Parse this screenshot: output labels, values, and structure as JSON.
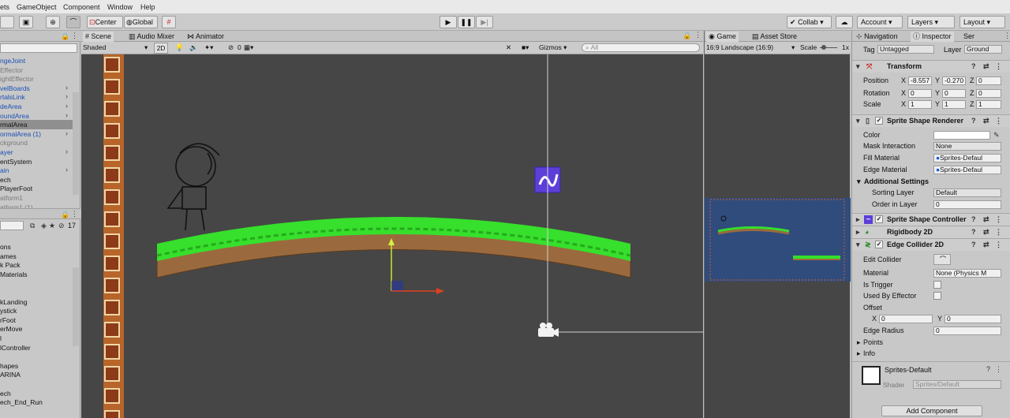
{
  "menu": {
    "items": [
      "ets",
      "GameObject",
      "Component",
      "Window",
      "Help"
    ]
  },
  "toolbar": {
    "center": "Center",
    "global": "Global",
    "collab": "Collab ▾",
    "account": "Account ▾",
    "layers": "Layers ▾",
    "layout": "Layout ▾"
  },
  "hierarchy": {
    "items": [
      {
        "label": "ngeJoint",
        "cls": "blue"
      },
      {
        "label": "Effector",
        "cls": "grey"
      },
      {
        "label": "ightEffector",
        "cls": "grey"
      },
      {
        "label": "velBoards",
        "cls": "blue"
      },
      {
        "label": "rtalsLink",
        "cls": "blue"
      },
      {
        "label": "deArea",
        "cls": "blue"
      },
      {
        "label": "oundArea",
        "cls": "blue"
      },
      {
        "label": "rmalArea",
        "cls": "sel"
      },
      {
        "label": "ormalArea (1)",
        "cls": "blue"
      },
      {
        "label": "ckground",
        "cls": "grey"
      },
      {
        "label": "ayer",
        "cls": "blue"
      },
      {
        "label": "entSystem",
        "cls": ""
      },
      {
        "label": "ain",
        "cls": "blue"
      },
      {
        "label": "ech",
        "cls": ""
      },
      {
        "label": "PlayerFoot",
        "cls": ""
      },
      {
        "label": "atform1",
        "cls": "grey"
      },
      {
        "label": "atform1 (1)",
        "cls": "grey"
      }
    ],
    "count": "17",
    "project_items": [
      "ons",
      "ames",
      "k Pack",
      "Materials",
      "",
      "",
      "kLanding",
      "ystick",
      "rFoot",
      "erMove",
      "l",
      "lController",
      "",
      "hapes",
      "ARINA",
      "",
      "ech",
      "ech_End_Run"
    ]
  },
  "scene": {
    "tabs": [
      "Scene",
      "Audio Mixer",
      "Animator"
    ],
    "shaded": "Shaded",
    "mode2d": "2D",
    "layers_count": "0",
    "gizmos": "Gizmos",
    "search_placeholder": "All"
  },
  "game": {
    "tabs": [
      "Game",
      "Asset Store"
    ],
    "aspect": "16:9 Landscape (16:9)",
    "scale_label": "Scale",
    "scale_value": "1x"
  },
  "inspector": {
    "tabs": [
      "Navigation",
      "Inspector",
      "Ser"
    ],
    "tag_label": "Tag",
    "tag_value": "Untagged",
    "layer_label": "Layer",
    "layer_value": "Ground",
    "transform": {
      "title": "Transform",
      "position_label": "Position",
      "pos_x": "-8.557",
      "pos_y": "-0.270",
      "pos_z": "0",
      "rotation_label": "Rotation",
      "rot_x": "0",
      "rot_y": "0",
      "rot_z": "0",
      "scale_label": "Scale",
      "scl_x": "1",
      "scl_y": "1",
      "scl_z": "1"
    },
    "renderer": {
      "title": "Sprite Shape Renderer",
      "color_label": "Color",
      "mask_label": "Mask Interaction",
      "mask_value": "None",
      "fill_label": "Fill Material",
      "fill_value": "Sprites-Defaul",
      "edge_label": "Edge Material",
      "edge_value": "Sprites-Defaul",
      "additional": "Additional Settings",
      "sorting_label": "Sorting Layer",
      "sorting_value": "Default",
      "order_label": "Order in Layer",
      "order_value": "0"
    },
    "controller_title": "Sprite Shape Controller",
    "rigidbody_title": "Rigidbody 2D",
    "edge": {
      "title": "Edge Collider 2D",
      "edit_label": "Edit Collider",
      "material_label": "Material",
      "material_value": "None (Physics M",
      "trigger_label": "Is Trigger",
      "effector_label": "Used By Effector",
      "offset_label": "Offset",
      "off_x": "0",
      "off_y": "0",
      "radius_label": "Edge Radius",
      "radius_value": "0",
      "points_label": "Points",
      "info_label": "Info"
    },
    "material": {
      "name": "Sprites-Default",
      "shader_label": "Shader",
      "shader_value": "Sprites/Default"
    },
    "add_component": "Add Component"
  },
  "axis_labels": {
    "x": "X",
    "y": "Y",
    "z": "Z"
  },
  "colors": {
    "scene_bg": "#464646",
    "grass": "#36e02c",
    "soil": "#9a6a3e",
    "game_bg": "#2f4c7c",
    "accent": "#5b3fd8"
  }
}
